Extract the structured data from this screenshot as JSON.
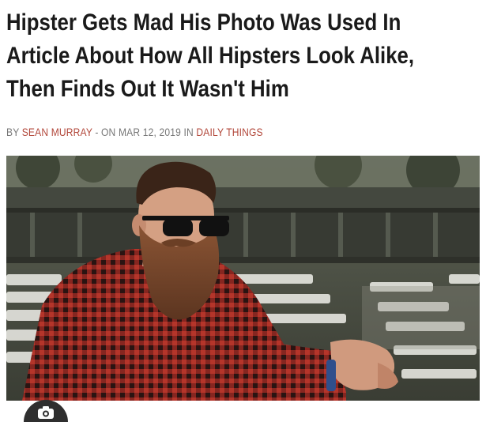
{
  "article": {
    "headline_lines": [
      "Hipster Gets Mad His Photo Was Used In",
      "Article About How All Hipsters Look Alike,",
      "Then Finds Out It Wasn't Him"
    ],
    "byline": {
      "by": "BY",
      "author": "SEAN MURRAY",
      "date_text": "- ON MAR 12, 2019 IN",
      "category": "DAILY THINGS"
    }
  },
  "image": {
    "subject": "bearded-man-sunglasses-plaid-shirt",
    "colors": {
      "shirt_red": "#b5352a",
      "shirt_dark": "#2a1412",
      "beard": "#7a4a2c",
      "skin": "#d4a083",
      "sunglasses": "#111111",
      "foliage": "#4f5545",
      "stands": "#3d4038",
      "chairs": "#e6e6e0"
    }
  },
  "overlay": {
    "icon": "camera-search-icon",
    "color": "#2f2f2f"
  }
}
